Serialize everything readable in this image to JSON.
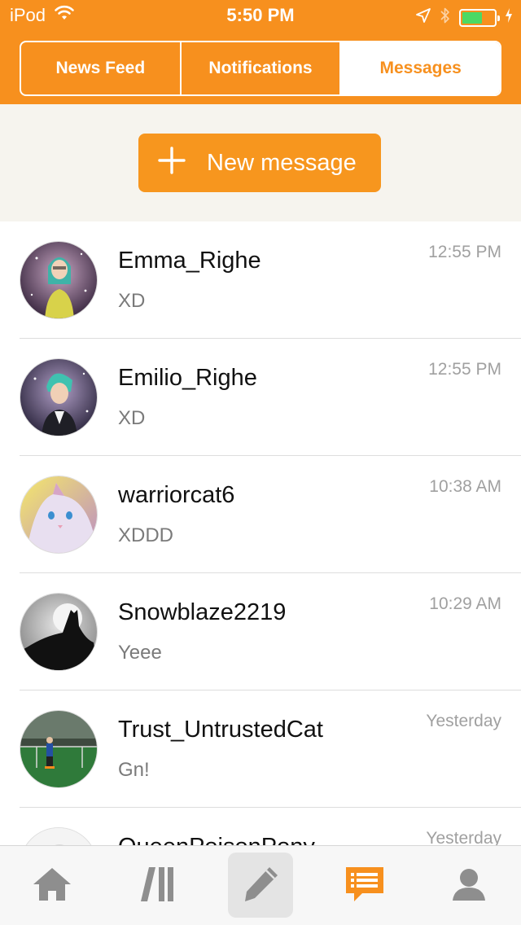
{
  "status_bar": {
    "carrier": "iPod",
    "time": "5:50 PM",
    "battery_color": "#4cd964"
  },
  "header": {
    "accent": "#f7901e",
    "tabs": [
      {
        "label": "News Feed",
        "active": false
      },
      {
        "label": "Notifications",
        "active": false
      },
      {
        "label": "Messages",
        "active": true
      }
    ]
  },
  "compose": {
    "button_label": "New message",
    "icon": "plus-icon"
  },
  "messages": [
    {
      "name": "Emma_Righe",
      "preview": "XD",
      "time": "12:55 PM"
    },
    {
      "name": "Emilio_Righe",
      "preview": "XD",
      "time": "12:55 PM"
    },
    {
      "name": "warriorcat6",
      "preview": "XDDD",
      "time": "10:38 AM"
    },
    {
      "name": "Snowblaze2219",
      "preview": "Yeee",
      "time": "10:29 AM"
    },
    {
      "name": "Trust_UntrustedCat",
      "preview": "Gn!",
      "time": "Yesterday"
    },
    {
      "name": "QueenPoisonPony",
      "preview": "",
      "time": "Yesterday"
    }
  ],
  "tabbar": {
    "items": [
      "home-icon",
      "feed-icon",
      "compose-icon",
      "messages-icon",
      "profile-icon"
    ],
    "active": "messages-icon",
    "active_color": "#f7901e",
    "inactive_color": "#8e8e8e"
  }
}
